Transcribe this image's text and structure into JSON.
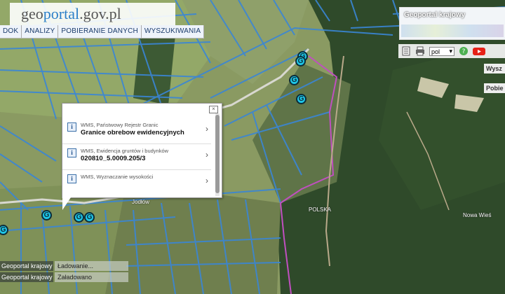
{
  "logo": {
    "prefix": "geo",
    "brand": "portal",
    "suffix": ".gov.pl"
  },
  "menu": [
    "DOK",
    "ANALIZY",
    "POBIERANIE DANYCH",
    "WYSZUKIWANIA"
  ],
  "overview": {
    "title": "Geoportal krajowy"
  },
  "toolbar": {
    "language": "pol"
  },
  "side_buttons": [
    "Wysz",
    "Pobie"
  ],
  "popup": {
    "rows": [
      {
        "source": "WMS, Państwowy Rejestr Granic",
        "value": "Granice obrebow ewidencyjnych"
      },
      {
        "source": "WMS, Ewidencja gruntów i budynków",
        "value": "020810_5.0009.205/3"
      },
      {
        "source": "WMS, Wyznaczanie wysokości",
        "value": ""
      }
    ]
  },
  "map_labels": {
    "place1": "Jodłów",
    "country": "POLSKA",
    "place2": "Nowa Wieś"
  },
  "status": [
    {
      "key": "Geoportal krajowy",
      "value": "Ładowanie..."
    },
    {
      "key": "Geoportal krajowy",
      "value": "Załadowano"
    }
  ],
  "colors": {
    "parcel_lines": "#3a86d6",
    "border_line": "#c04fc0",
    "forest": "#2f4a2a",
    "marker": "#1ec7e8"
  }
}
